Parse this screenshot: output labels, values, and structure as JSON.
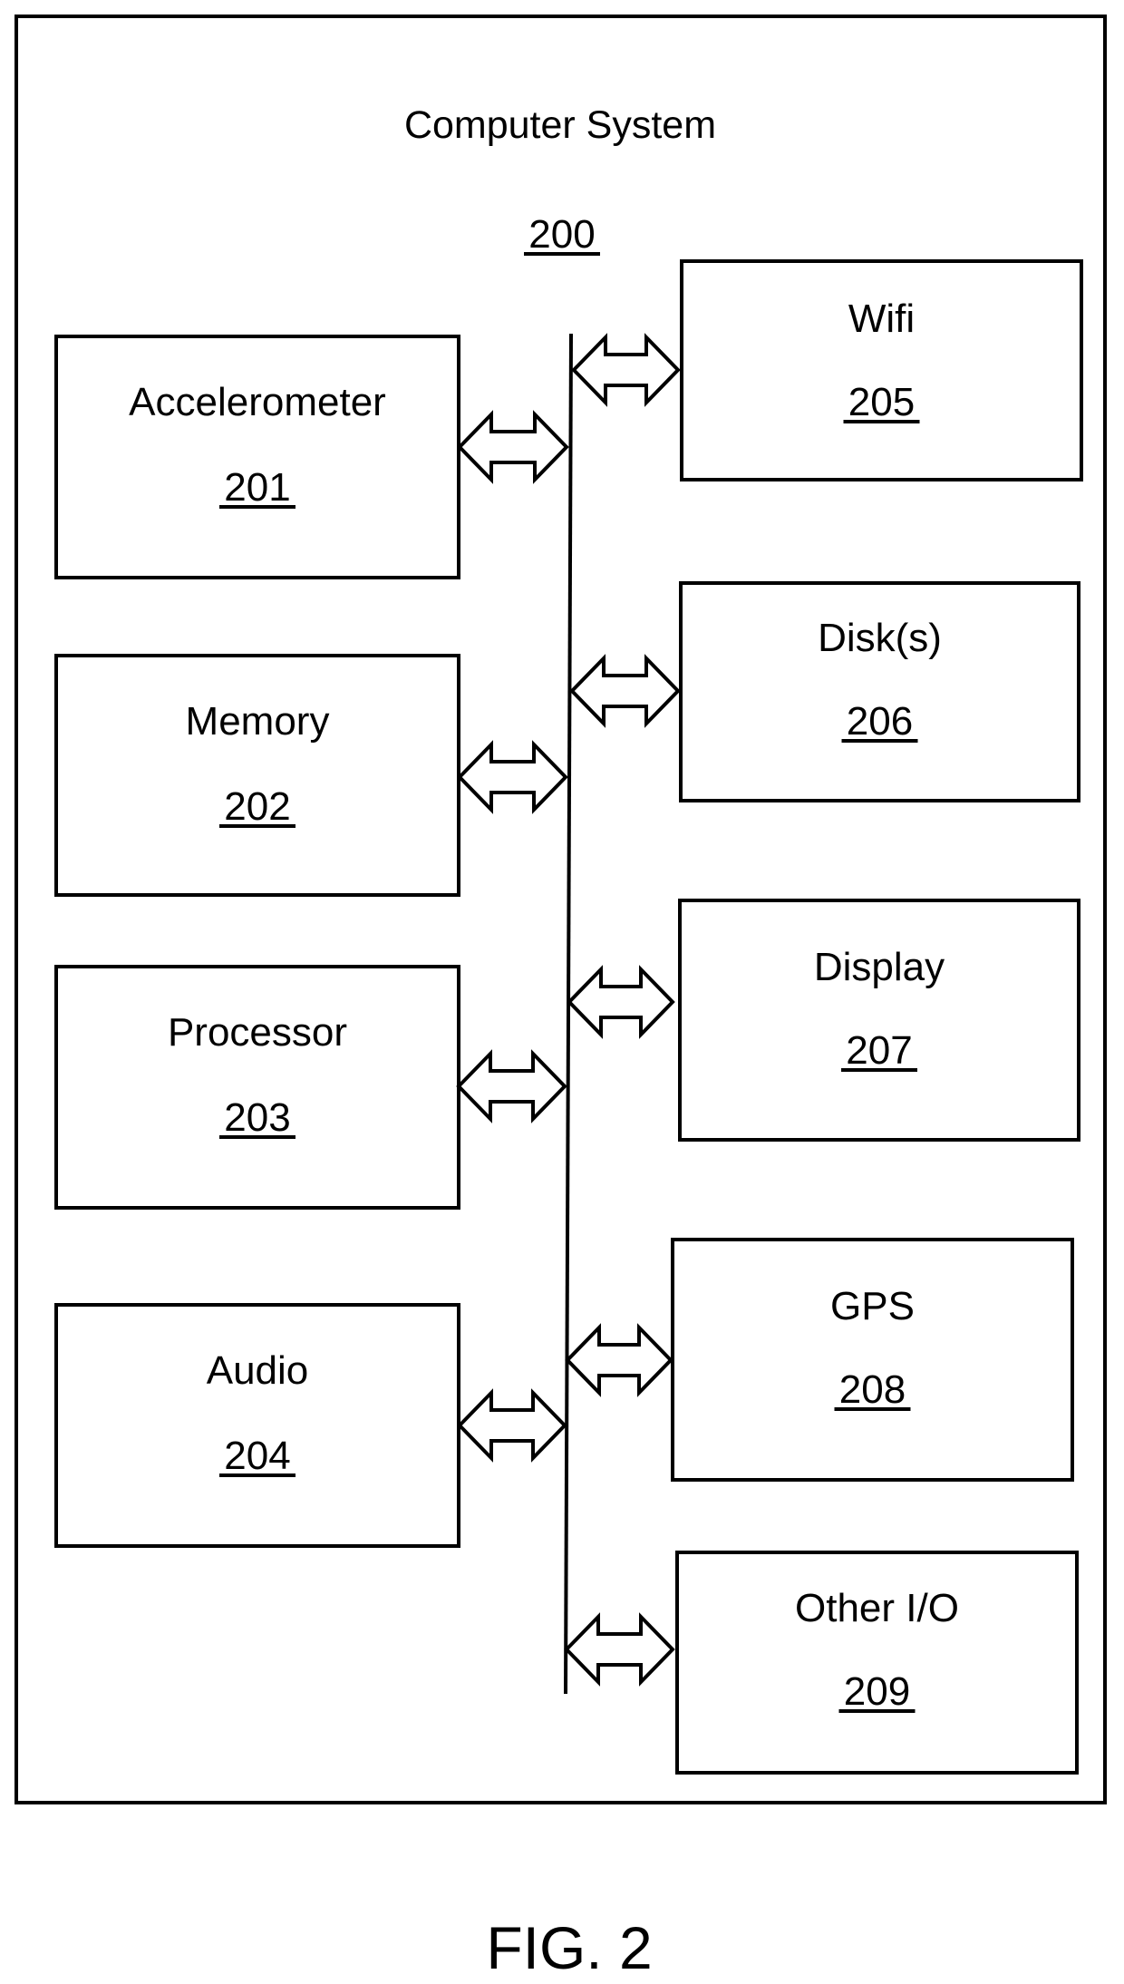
{
  "figure": {
    "title": "Computer System",
    "ref": "200",
    "caption": "FIG. 2",
    "line_color": "#000000",
    "background": "#ffffff"
  },
  "bus": {
    "name": "system-bus",
    "connections": "bidirectional"
  },
  "components": {
    "left": [
      {
        "id": "accelerometer",
        "label": "Accelerometer",
        "ref": "201"
      },
      {
        "id": "memory",
        "label": "Memory",
        "ref": "202"
      },
      {
        "id": "processor",
        "label": "Processor",
        "ref": "203"
      },
      {
        "id": "audio",
        "label": "Audio",
        "ref": "204"
      }
    ],
    "right": [
      {
        "id": "wifi",
        "label": "Wifi",
        "ref": "205"
      },
      {
        "id": "disks",
        "label": "Disk(s)",
        "ref": "206"
      },
      {
        "id": "display",
        "label": "Display",
        "ref": "207"
      },
      {
        "id": "gps",
        "label": "GPS",
        "ref": "208"
      },
      {
        "id": "other-io",
        "label": "Other I/O",
        "ref": "209"
      }
    ]
  }
}
